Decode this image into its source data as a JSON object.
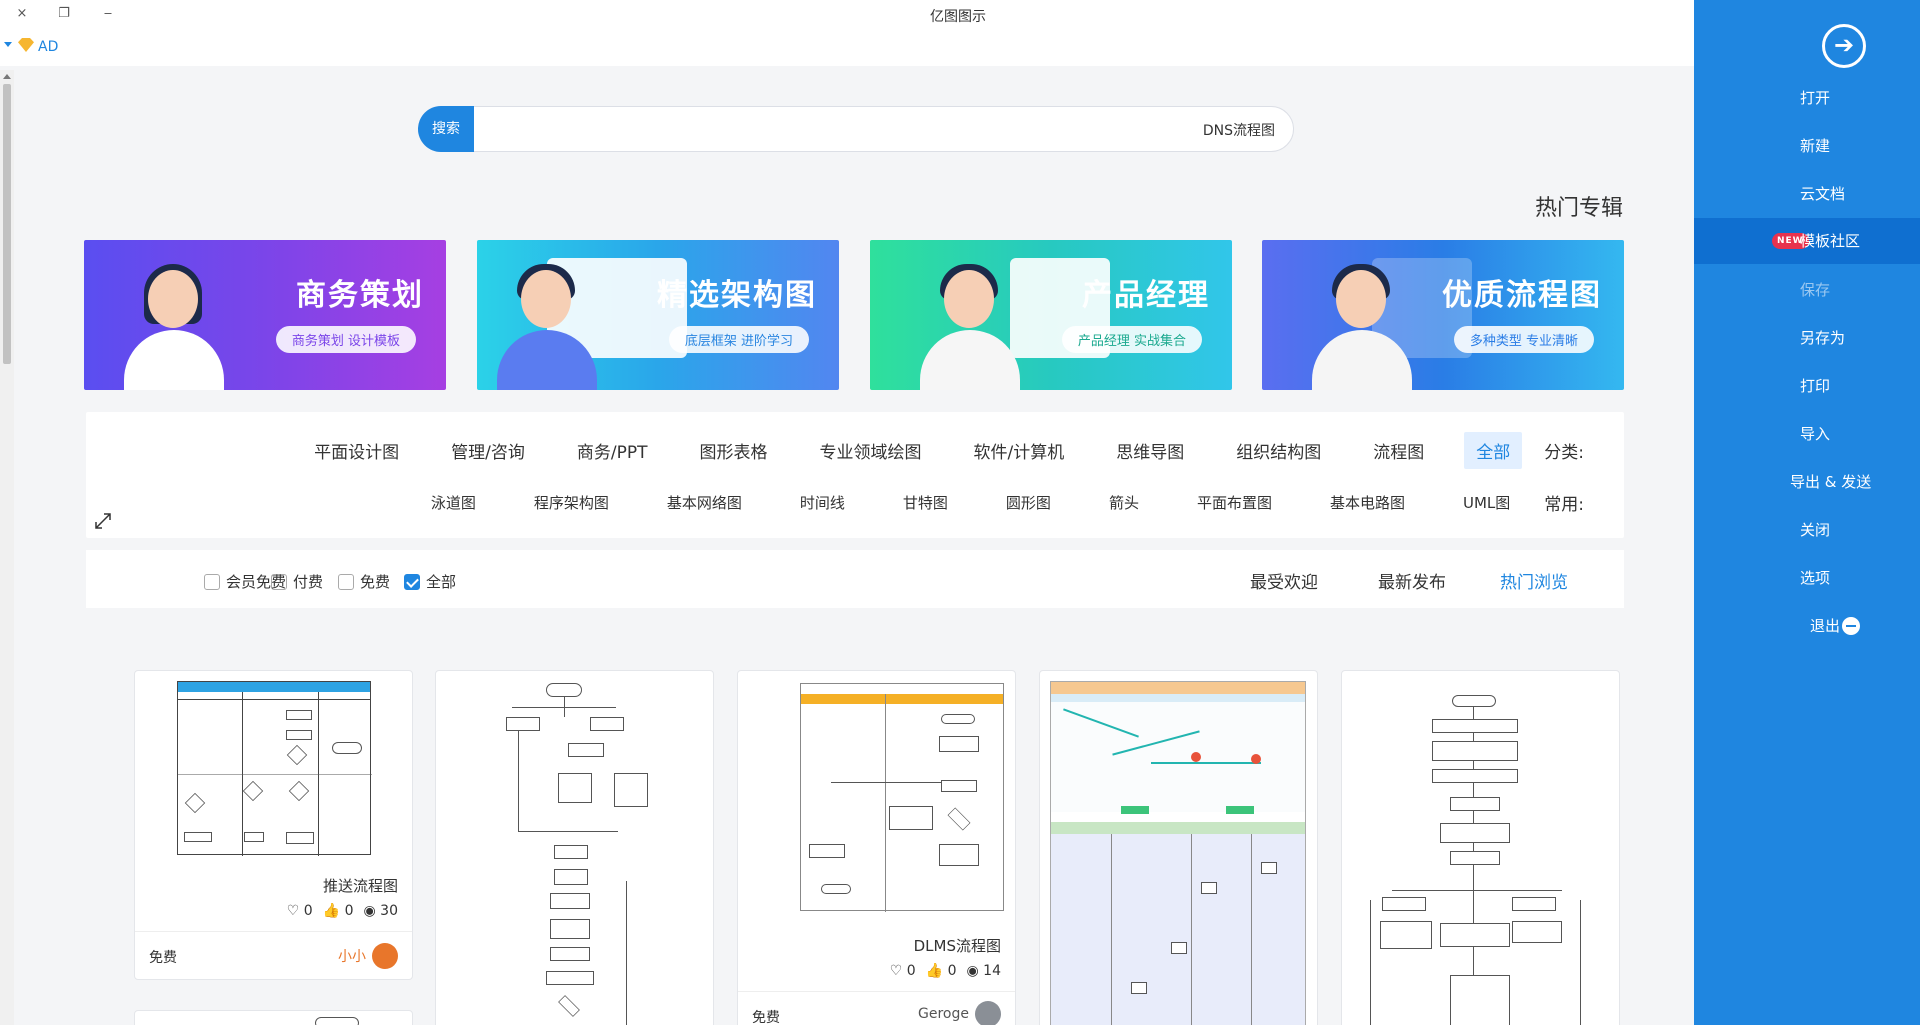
{
  "window": {
    "title": "亿图图示",
    "controls": {
      "close": "×",
      "restore": "❐",
      "minimize": "‒"
    }
  },
  "user": {
    "label": "AD"
  },
  "search": {
    "button": "搜索",
    "value": "DNS流程图"
  },
  "section_title": "热门专辑",
  "banners": [
    {
      "title": "优质流程图",
      "subtitle": "多种类型 专业清晰",
      "bg": "#2a7de6"
    },
    {
      "title": "产品经理",
      "subtitle": "产品经理 实战集合",
      "bg": "#27c9c0"
    },
    {
      "title": "精选架构图",
      "subtitle": "底层框架 进阶学习",
      "bg": "#2aa6ea"
    },
    {
      "title": "商务策划",
      "subtitle": "商务策划 设计模板",
      "bg": "#7b45e9"
    }
  ],
  "categories": {
    "label": "分类:",
    "items": [
      "全部",
      "流程图",
      "组织结构图",
      "思维导图",
      "软件/计算机",
      "专业领域绘图",
      "图形表格",
      "商务/PPT",
      "管理/咨询",
      "平面设计图"
    ],
    "active": "全部"
  },
  "common": {
    "label": "常用:",
    "items": [
      "UML图",
      "基本电路图",
      "平面布置图",
      "箭头",
      "圆形图",
      "甘特图",
      "时间线",
      "基本网络图",
      "程序架构图",
      "泳道图"
    ]
  },
  "sort_tabs": [
    "热门浏览",
    "最新发布",
    "最受欢迎"
  ],
  "sort_active": "热门浏览",
  "filters": [
    {
      "label": "全部",
      "checked": true
    },
    {
      "label": "免费",
      "checked": false
    },
    {
      "label": "付费",
      "checked": false
    },
    {
      "label": "会员免费",
      "checked": false
    }
  ],
  "cards": [
    {
      "name": "推送流程图",
      "views": "30",
      "likes": "0",
      "favs": "0",
      "author": "小小",
      "price": "免费"
    },
    {
      "name": "DLMS流程图",
      "views": "14",
      "likes": "0",
      "favs": "0",
      "author": "Geroge",
      "price": "免费"
    }
  ],
  "sidebar": {
    "items": [
      {
        "label": "打开"
      },
      {
        "label": "新建"
      },
      {
        "label": "云文档"
      },
      {
        "label": "模板社区",
        "badge": "NEW"
      },
      {
        "label": "保存"
      },
      {
        "label": "另存为"
      },
      {
        "label": "打印"
      },
      {
        "label": "导入"
      },
      {
        "label": "导出 & 发送"
      },
      {
        "label": "关闭"
      },
      {
        "label": "选项"
      },
      {
        "label": "退出"
      }
    ]
  },
  "colors": {
    "accent": "#1f86e0",
    "sidebar_bg": "#1f86e0",
    "badge": "#e8324e"
  }
}
